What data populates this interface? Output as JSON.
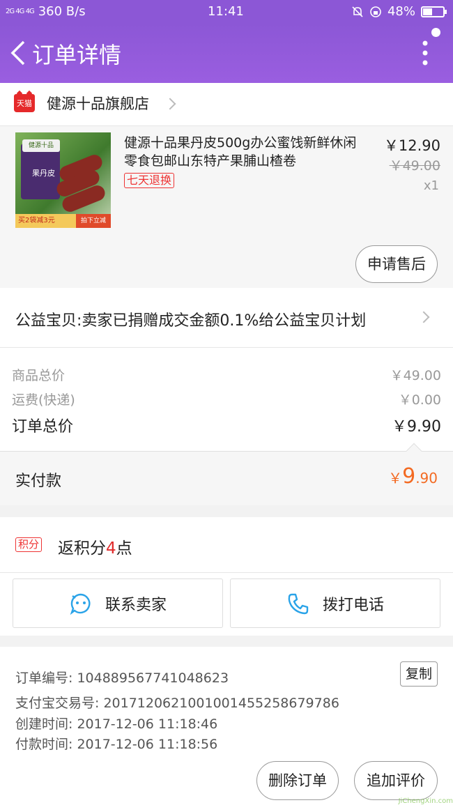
{
  "status_bar": {
    "signal": "2G 4G 4G",
    "speed": "360 B/s",
    "time": "11:41",
    "battery": "48%",
    "battery_level": 0.48
  },
  "header": {
    "title": "订单详情"
  },
  "shop": {
    "badge": "天猫",
    "name": "健源十品旗舰店"
  },
  "product": {
    "title": "健源十品果丹皮500g办公蜜饯新鲜休闲零食包邮山东特产果脯山楂卷",
    "return_tag": "七天退换",
    "price": "￥12.90",
    "original_price": "￥49.00",
    "quantity": "x1",
    "after_sale_label": "申请售后",
    "image": {
      "brand": "健源十品",
      "product_name": "果丹皮",
      "promo_left": "买2袋减3元",
      "promo_right": "拍下立减"
    }
  },
  "charity": {
    "text": "公益宝贝:卖家已捐赠成交金额0.1%给公益宝贝计划"
  },
  "totals": {
    "goods_label": "商品总价",
    "goods_value": "￥49.00",
    "shipping_label": "运费(快递)",
    "shipping_value": "￥0.00",
    "order_label": "订单总价",
    "order_value": "￥9.90"
  },
  "payment": {
    "label": "实付款",
    "currency": "￥",
    "amount_int": "9",
    "amount_dec": ".90"
  },
  "points": {
    "badge": "积分",
    "prefix": "返积分",
    "count": "4",
    "suffix": "点"
  },
  "contact": {
    "seller_label": "联系卖家",
    "phone_label": "拨打电话"
  },
  "order_info": {
    "order_no": "订单编号: 104889567741048623",
    "copy_label": "复制",
    "alipay_no": "支付宝交易号: 2017120621001001455258679786",
    "created": "创建时间: 2017-12-06 11:18:46",
    "paid": "付款时间: 2017-12-06 11:18:56"
  },
  "footer": {
    "delete_label": "删除订单",
    "review_label": "追加评价",
    "watermark": "JiChengXin.com"
  },
  "colors": {
    "header_purple": "#8c57d6",
    "accent_orange": "#f36a22",
    "tag_red": "#e33333",
    "icon_blue": "#2aa3e8"
  }
}
